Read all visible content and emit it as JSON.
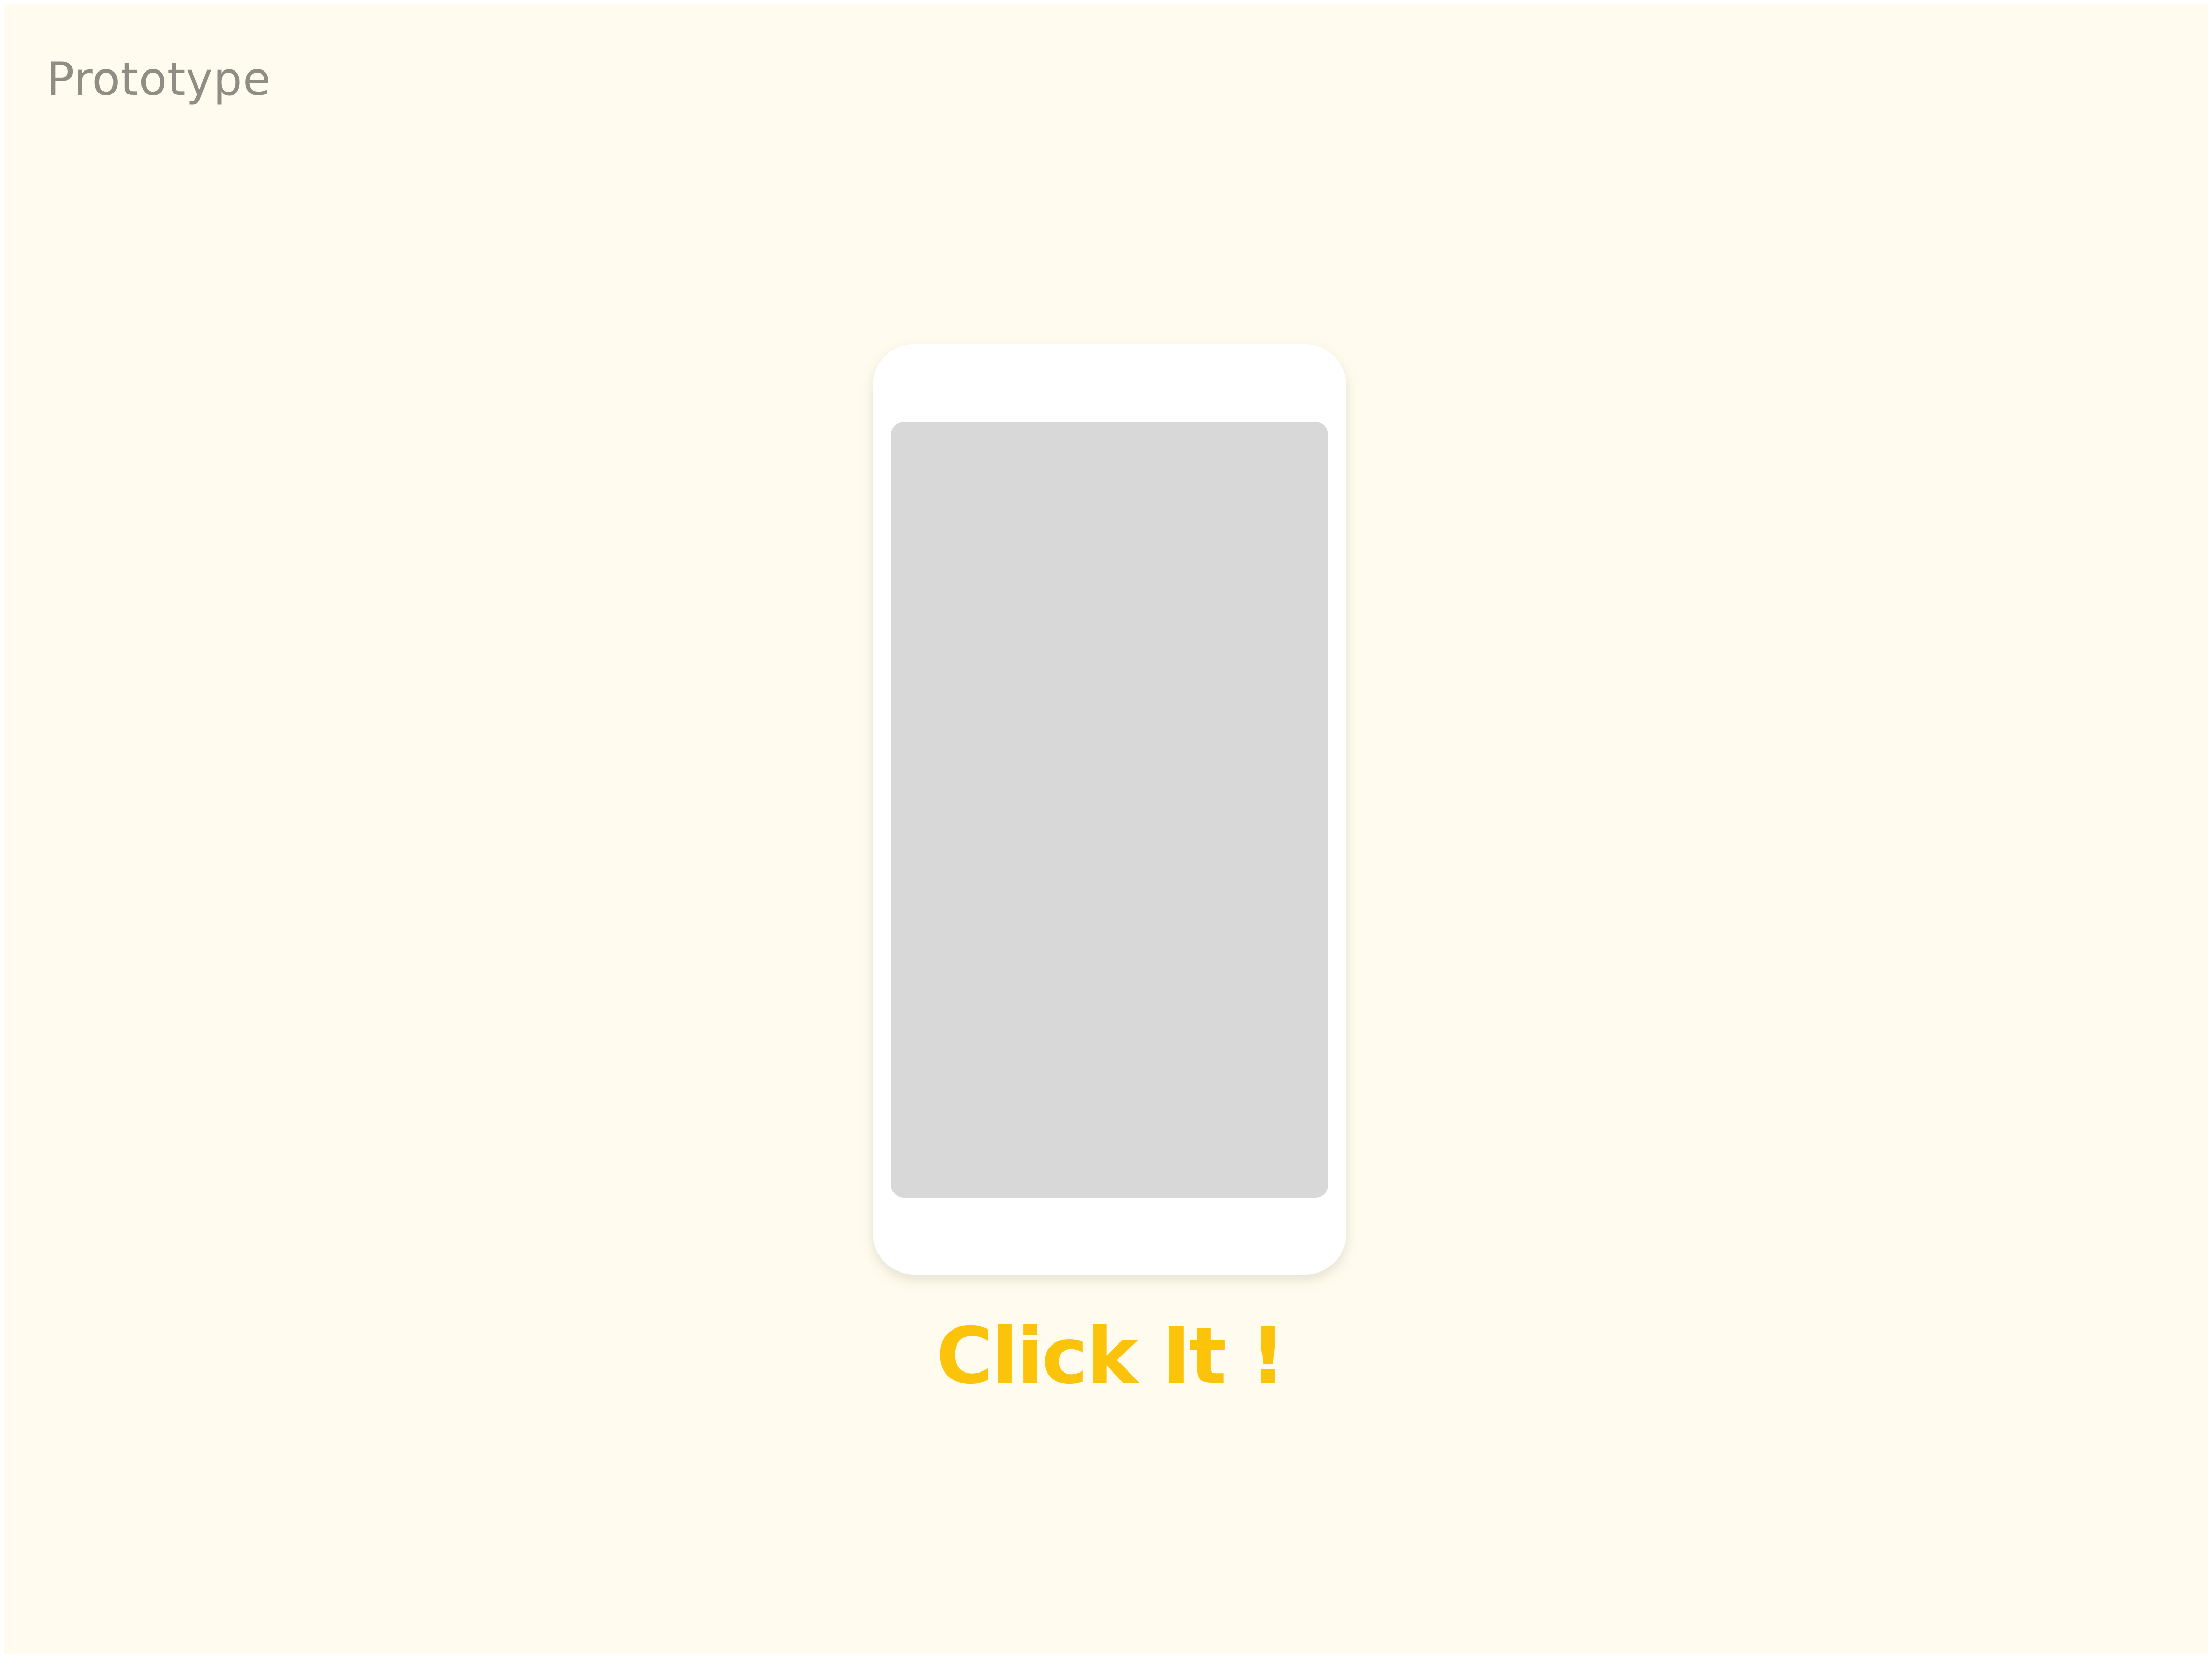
{
  "page": {
    "title": "Prototype",
    "background_color": "#fffcef"
  },
  "phone": {
    "frame_color": "#ffffff",
    "screen_color": "#d8d8d8"
  },
  "cta": {
    "label": "Click It !",
    "color": "#fbc30a"
  }
}
